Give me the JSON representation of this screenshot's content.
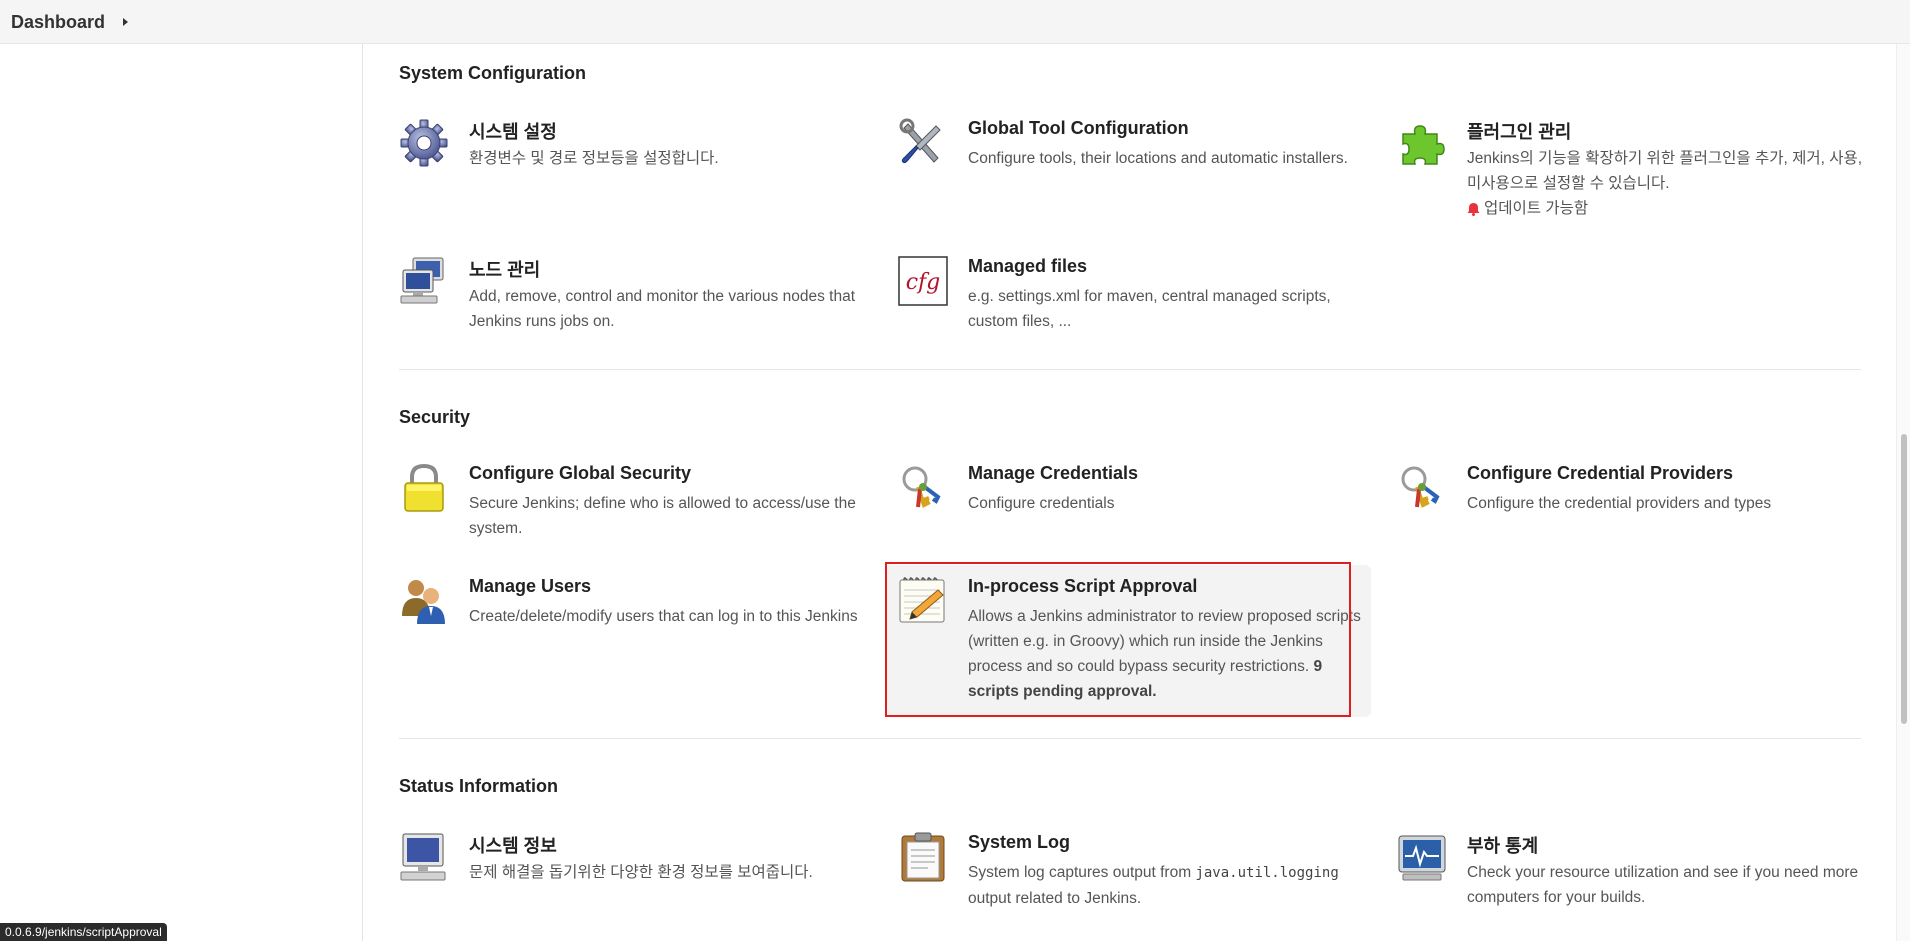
{
  "breadcrumb": {
    "dashboard": "Dashboard"
  },
  "sections": {
    "system_configuration": "System Configuration",
    "security": "Security",
    "status_information": "Status Information"
  },
  "items": {
    "system_settings": {
      "title": "시스템 설정",
      "desc": "환경변수 및 경로 정보등을 설정합니다.",
      "icon": "gear-icon"
    },
    "global_tool": {
      "title": "Global Tool Configuration",
      "desc": "Configure tools, their locations and automatic installers.",
      "icon": "wrench-screwdriver-icon"
    },
    "plugin_manager": {
      "title": "플러그인 관리",
      "desc": "Jenkins의 기능을 확장하기 위한 플러그인을 추가, 제거, 사용, 미사용으로 설정할 수 있습니다.",
      "alert": "업데이트 가능함",
      "icon": "puzzle-piece-icon"
    },
    "node_manager": {
      "title": "노드 관리",
      "desc": "Add, remove, control and monitor the various nodes that Jenkins runs jobs on.",
      "icon": "computers-icon"
    },
    "managed_files": {
      "title": "Managed files",
      "desc": "e.g. settings.xml for maven, central managed scripts, custom files, ...",
      "icon": "cfg-file-icon"
    },
    "global_security": {
      "title": "Configure Global Security",
      "desc": "Secure Jenkins; define who is allowed to access/use the system.",
      "icon": "padlock-icon"
    },
    "manage_credentials": {
      "title": "Manage Credentials",
      "desc": "Configure credentials",
      "icon": "keys-icon"
    },
    "credential_providers": {
      "title": "Configure Credential Providers",
      "desc": "Configure the credential providers and types",
      "icon": "keys-icon"
    },
    "manage_users": {
      "title": "Manage Users",
      "desc": "Create/delete/modify users that can log in to this Jenkins",
      "icon": "users-icon"
    },
    "script_approval": {
      "title": "In-process Script Approval",
      "desc": "Allows a Jenkins administrator to review proposed scripts (written e.g. in Groovy) which run inside the Jenkins process and so could bypass security restrictions.",
      "pending": "9 scripts pending approval.",
      "icon": "notepad-pencil-icon"
    },
    "system_info": {
      "title": "시스템 정보",
      "desc": "문제 해결을 돕기위한 다양한 환경 정보를 보여줍니다.",
      "icon": "computer-icon"
    },
    "system_log": {
      "title": "System Log",
      "desc_before": "System log captures output from",
      "desc_code": "java.util.logging",
      "desc_after": "output related to Jenkins.",
      "icon": "clipboard-icon"
    },
    "load_stats": {
      "title": "부하 통계",
      "desc": "Check your resource utilization and see if you need more computers for your builds.",
      "icon": "monitor-graph-icon"
    }
  },
  "status_url": "0.0.6.9/jenkins/scriptApproval",
  "colors": {
    "highlight_border": "#e01e1e",
    "alert_red": "#e8333a"
  }
}
